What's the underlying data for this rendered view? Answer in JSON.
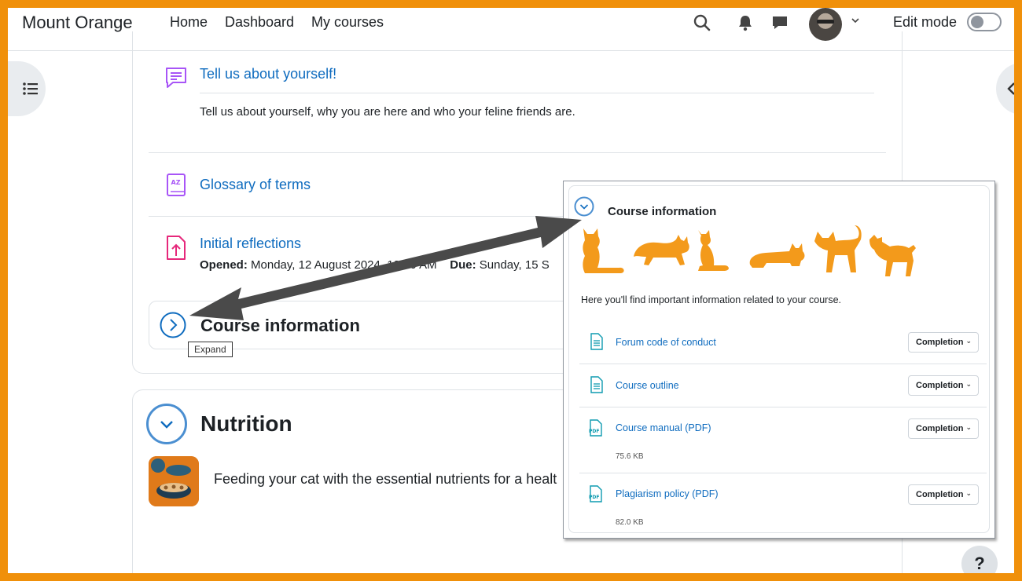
{
  "navbar": {
    "brand": "Mount Orange",
    "links": [
      "Home",
      "Dashboard",
      "My courses"
    ],
    "edit_mode_label": "Edit mode"
  },
  "activities": {
    "forum": {
      "title": "Tell us about yourself!",
      "description": "Tell us about yourself, why you are here and who your feline friends are."
    },
    "glossary": {
      "title": "Glossary of terms"
    },
    "assignment": {
      "title": "Initial reflections",
      "opened_label": "Opened:",
      "opened_value": "Monday, 12 August 2024, 12:00 AM",
      "due_label": "Due:",
      "due_value": "Sunday, 15 S"
    }
  },
  "course_info_section": {
    "title": "Course information",
    "tooltip": "Expand"
  },
  "nutrition_section": {
    "title": "Nutrition",
    "description": "Feeding your cat with the essential nutrients for a healt"
  },
  "popup": {
    "title": "Course information",
    "intro": "Here you'll find important information related to your course.",
    "completion_label": "Completion",
    "items": [
      {
        "title": "Forum code of conduct",
        "size": ""
      },
      {
        "title": "Course outline",
        "size": ""
      },
      {
        "title": "Course manual (PDF)",
        "size": "75.6 KB"
      },
      {
        "title": "Plagiarism policy (PDF)",
        "size": "82.0 KB"
      }
    ]
  },
  "help": {
    "label": "?"
  },
  "colors": {
    "frame": "#f0900a",
    "link": "#0f6cbf",
    "cat_orange": "#f39a1b",
    "forum_icon": "#a855f7",
    "assignment_icon": "#e6287b",
    "resource_icon": "#0f9bb0"
  }
}
